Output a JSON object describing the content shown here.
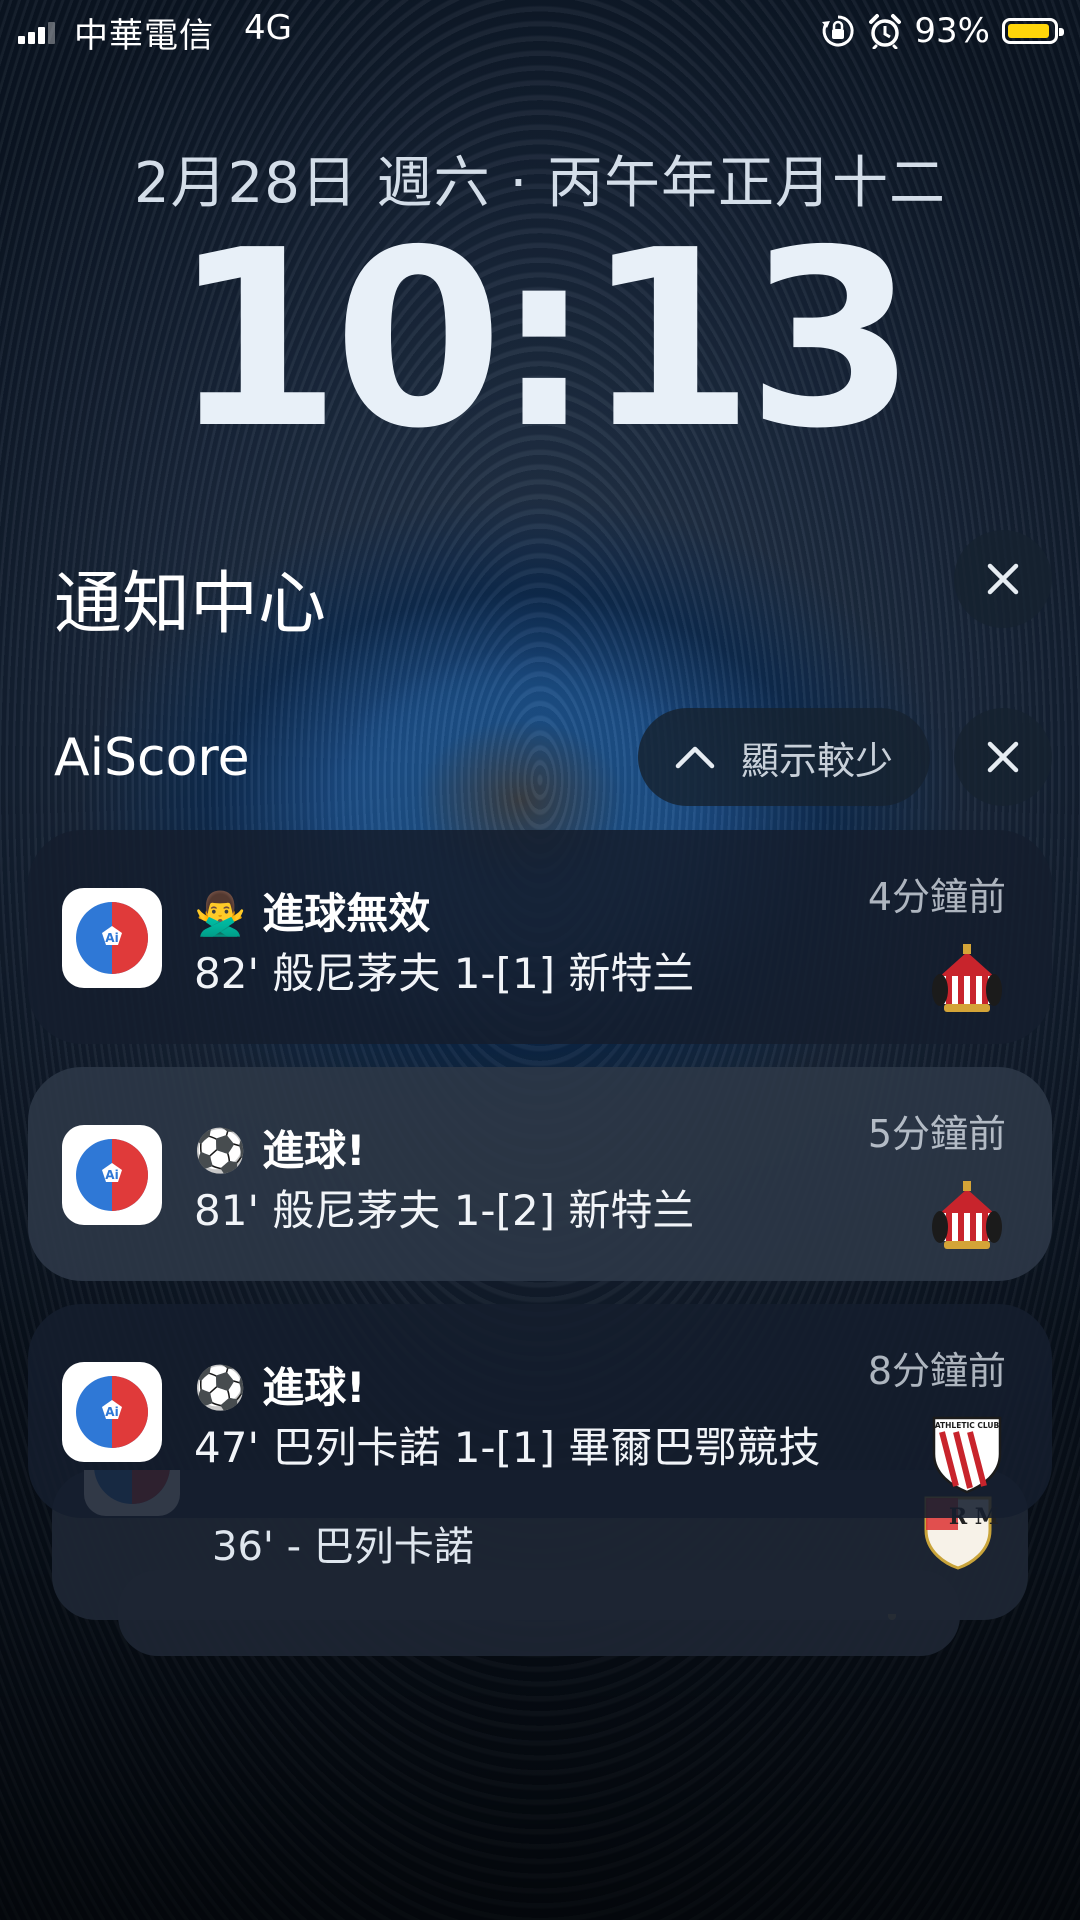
{
  "status_bar": {
    "carrier": "中華電信",
    "network": "4G",
    "battery_percent": "93%",
    "battery_level": 0.93,
    "battery_color": "#ffd60a",
    "icons": [
      "signal-icon",
      "orientation-lock-icon",
      "alarm-icon",
      "battery-icon"
    ]
  },
  "lock_screen": {
    "date": "2月28日 週六 · 丙午年正月十二",
    "time": "10:13"
  },
  "notification_center": {
    "title": "通知中心"
  },
  "app_group": {
    "app_name": "AiScore",
    "show_less_label": "顯示較少",
    "app_icon_colors": {
      "blue": "#2f78d6",
      "red": "#e03a3a"
    },
    "notifications": [
      {
        "emoji": "🙅‍♂️",
        "title": "進球無效",
        "body": "82' 般尼茅夫 1-[1] 新特兰",
        "time": "4分鐘前",
        "crest": "sunderland-crest-icon"
      },
      {
        "emoji": "⚽",
        "title": "進球!",
        "body": "81' 般尼茅夫 1-[2] 新特兰",
        "time": "5分鐘前",
        "crest": "sunderland-crest-icon"
      },
      {
        "emoji": "⚽",
        "title": "進球!",
        "body": "47' 巴列卡諾 1-[1] 畢爾巴鄂競技",
        "time": "8分鐘前",
        "crest": "athletic-club-crest-icon",
        "crest_text": "ATHLETIC CLUB"
      }
    ],
    "stacked_peek": {
      "body": "36' - 巴列卡諾",
      "crest": "rayo-vallecano-crest-icon",
      "crest_text": "R M"
    }
  }
}
